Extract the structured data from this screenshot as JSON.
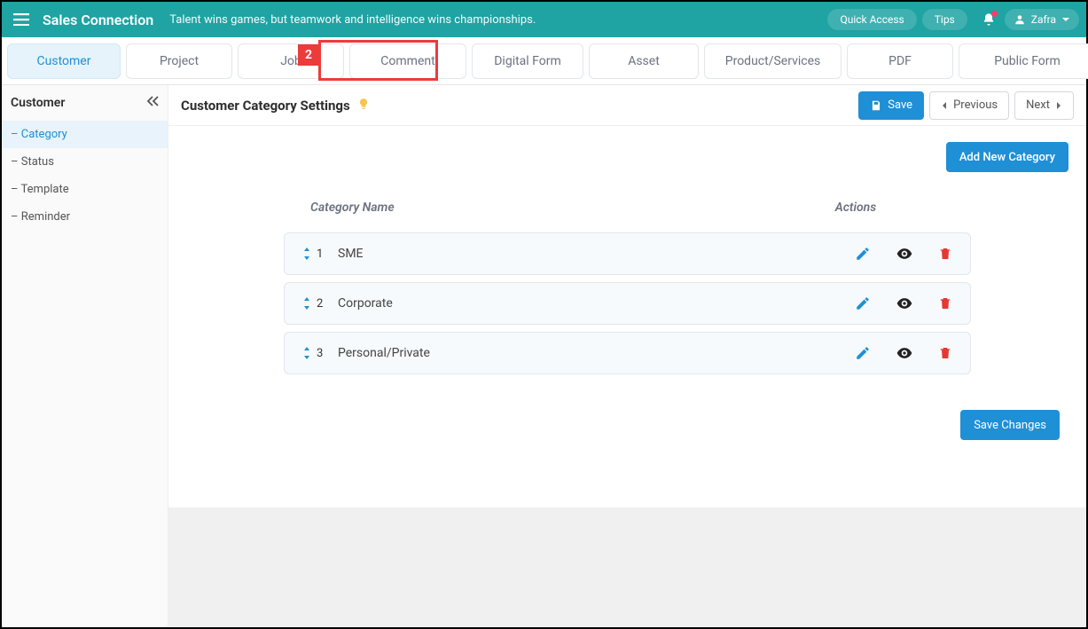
{
  "header": {
    "brand": "Sales Connection",
    "tagline": "Talent wins games, but teamwork and intelligence wins championships.",
    "quick_access": "Quick Access",
    "tips": "Tips",
    "user_name": "Zafra"
  },
  "tabs": {
    "items": [
      "Customer",
      "Project",
      "Job",
      "Comment",
      "Digital Form",
      "Asset",
      "Product/Services",
      "PDF",
      "Public Form"
    ],
    "active_index": 0,
    "callout_number": "2"
  },
  "sidebar": {
    "title": "Customer",
    "items": [
      {
        "label": "Category",
        "active": true
      },
      {
        "label": "Status",
        "active": false
      },
      {
        "label": "Template",
        "active": false
      },
      {
        "label": "Reminder",
        "active": false
      }
    ]
  },
  "panel": {
    "title": "Customer Category Settings",
    "save_btn": "Save",
    "prev_btn": "Previous",
    "next_btn": "Next",
    "add_btn": "Add New Category",
    "col_name": "Category Name",
    "col_actions": "Actions",
    "save_changes_btn": "Save Changes",
    "rows": [
      {
        "order": "1",
        "name": "SME"
      },
      {
        "order": "2",
        "name": "Corporate"
      },
      {
        "order": "3",
        "name": "Personal/Private"
      }
    ]
  }
}
